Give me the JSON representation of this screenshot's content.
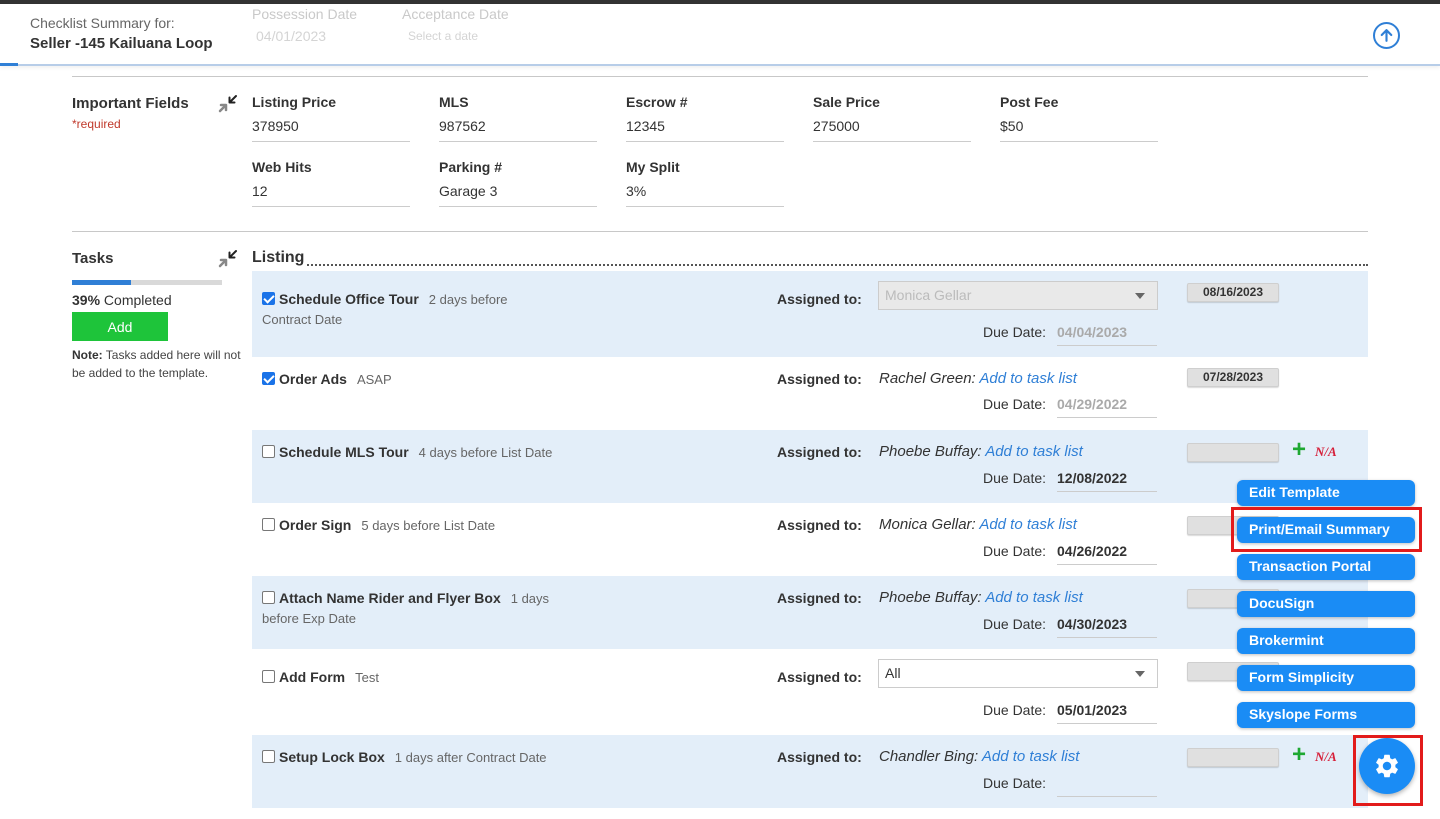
{
  "header": {
    "subtitle": "Checklist Summary for:",
    "title": "Seller -145 Kailuana Loop",
    "ghost_labels": [
      "Possession Date",
      "Acceptance Date"
    ],
    "ghost_values": [
      "04/01/2023",
      "Select a date"
    ]
  },
  "important_fields": {
    "title": "Important Fields",
    "required_note": "*required",
    "fields": [
      {
        "label": "Listing Price",
        "value": "378950"
      },
      {
        "label": "MLS",
        "value": "987562"
      },
      {
        "label": "Escrow #",
        "value": "12345"
      },
      {
        "label": "Sale Price",
        "value": "275000"
      },
      {
        "label": "Post Fee",
        "value": "$50"
      },
      {
        "label": "Web Hits",
        "value": "12"
      },
      {
        "label": "Parking #",
        "value": "Garage 3"
      },
      {
        "label": "My Split",
        "value": "3%"
      }
    ]
  },
  "tasks": {
    "title": "Tasks",
    "progress_fraction": 0.39,
    "percent": "39%",
    "completed_label": "Completed",
    "add_label": "Add",
    "note_bold": "Note:",
    "note_text": "Tasks added here will not be added to the template.",
    "group_heading": "Listing",
    "assigned_label": "Assigned to:",
    "due_label": "Due Date:",
    "add_to_list": "Add to task list",
    "na_label": "N/A",
    "items": [
      {
        "name": "Schedule Office Tour",
        "when_inline": "2 days before",
        "when_wrap": "Contract Date",
        "checked": true,
        "assignee": "Monica Gellar",
        "assignee_kind": "select-disabled",
        "due": "04/04/2023",
        "due_dim": true,
        "date_pill": "08/16/2023",
        "show_na": false
      },
      {
        "name": "Order Ads",
        "when_inline": "ASAP",
        "when_wrap": "",
        "checked": true,
        "assignee": "Rachel Green:",
        "assignee_kind": "text",
        "due": "04/29/2022",
        "due_dim": true,
        "date_pill": "07/28/2023",
        "show_na": false
      },
      {
        "name": "Schedule MLS Tour",
        "when_inline": "4 days before List Date",
        "when_wrap": "",
        "checked": false,
        "assignee": "Phoebe Buffay:",
        "assignee_kind": "text",
        "due": "12/08/2022",
        "due_dim": false,
        "date_pill": "",
        "show_na": true
      },
      {
        "name": "Order Sign",
        "when_inline": "5 days before List Date",
        "when_wrap": "",
        "checked": false,
        "assignee": "Monica Gellar:",
        "assignee_kind": "text",
        "due": "04/26/2022",
        "due_dim": false,
        "date_pill": "",
        "show_na": false
      },
      {
        "name": "Attach Name Rider and Flyer Box",
        "when_inline": "1 days",
        "when_wrap": "before Exp Date",
        "checked": false,
        "assignee": "Phoebe Buffay:",
        "assignee_kind": "text",
        "due": "04/30/2023",
        "due_dim": false,
        "date_pill": "",
        "show_na": false
      },
      {
        "name": "Add Form",
        "when_inline": "Test",
        "when_wrap": "",
        "checked": false,
        "assignee": "All",
        "assignee_kind": "select",
        "due": "05/01/2023",
        "due_dim": false,
        "date_pill": "",
        "show_na": false
      },
      {
        "name": "Setup Lock Box",
        "when_inline": "1 days after Contract Date",
        "when_wrap": "",
        "checked": false,
        "assignee": "Chandler Bing:",
        "assignee_kind": "text",
        "due": "",
        "due_dim": false,
        "date_pill": "",
        "show_na": true
      }
    ]
  },
  "action_menu": {
    "items": [
      "Edit Template",
      "Print/Email Summary",
      "Transaction Portal",
      "DocuSign",
      "Brokermint",
      "Form Simplicity",
      "Skyslope Forms"
    ],
    "highlighted": "Print/Email Summary"
  },
  "colors": {
    "accent": "#1a8cf5",
    "add_button": "#1ec43a",
    "highlight_box": "#e21b1b",
    "na_text": "#d6203a"
  }
}
